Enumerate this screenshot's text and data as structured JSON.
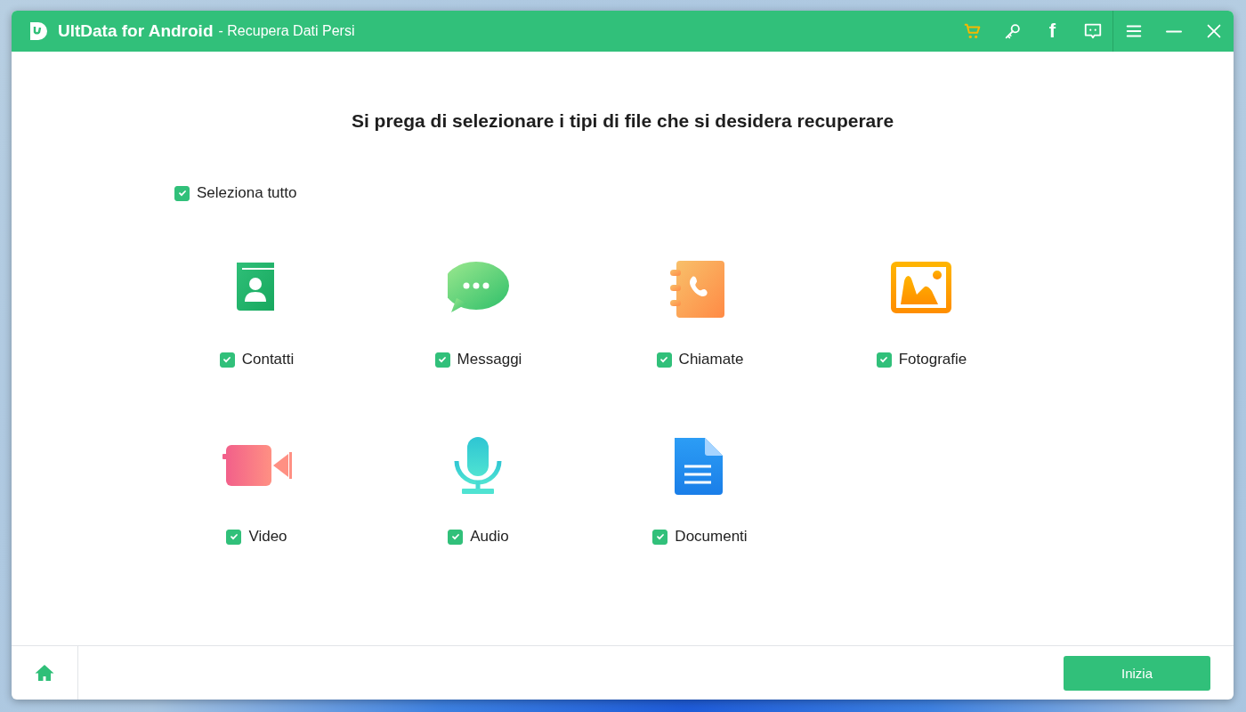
{
  "window": {
    "app_name": "UltData for Android",
    "subtitle": "- Recupera Dati Persi"
  },
  "title_bar": {
    "facebook_label": "f"
  },
  "heading": "Si prega di selezionare i tipi di file che si desidera recuperare",
  "select_all": {
    "label": "Seleziona tutto",
    "checked": true
  },
  "file_types": [
    {
      "label": "Contatti",
      "checked": true
    },
    {
      "label": "Messaggi",
      "checked": true
    },
    {
      "label": "Chiamate",
      "checked": true
    },
    {
      "label": "Fotografie",
      "checked": true
    },
    {
      "label": "Video",
      "checked": true
    },
    {
      "label": "Audio",
      "checked": true
    },
    {
      "label": "Documenti",
      "checked": true
    }
  ],
  "footer": {
    "start_button": "Inizia"
  }
}
